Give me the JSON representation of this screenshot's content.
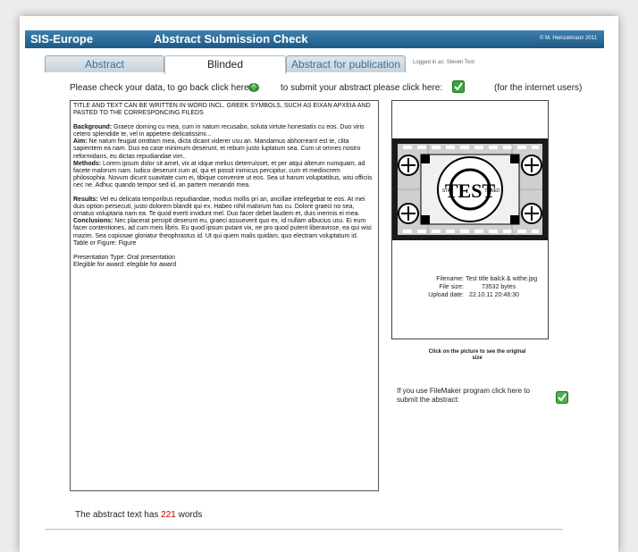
{
  "header": {
    "app_name": "SIS-Europe",
    "title": "Abstract Submission Check",
    "copyright": "© M. Heinzelmann 2011"
  },
  "tabs": [
    {
      "label": "Abstract",
      "active": false
    },
    {
      "label": "Blinded",
      "active": true
    },
    {
      "label": "Abstract for publication",
      "active": false
    }
  ],
  "logged_in": "Logged in as: Steven Test",
  "instructions": {
    "back_text": "Please check your data, to go back click here:",
    "submit_text": "to submit your abstract please click here:",
    "internet_note": "(for the internet users)",
    "back_icon": "back-arrow-icon",
    "submit_icon": "check-icon"
  },
  "abstract": {
    "heading": "TITLE AND TEXT CAN BE WRITTEN IN WORD INCL.  GREEK SYMBOLS, SUCH AS EΙΧΑΝ ΑΡΧΕΙΑ AND PASTED TO THE CORRESPONCING FILEDS",
    "background_label": "Background:",
    "background": " Graece doming cu mea, cum in natum recusabo, soluta virtute honestatis cu eos. Duo viris cetero splendide te, vel in appetere delicatissimi...",
    "aim_label": "Aim:",
    "aim": " Ne natum feugiat omittam mea, dicta dicant viderer usu an. Mandamus abhorreant est te, clita sapientem ea nam. Duo ea case minimum deserunt, et rebum justo luptatum sea. Cum ut omnes nostro reformidans, eu dictas repudiandae vim..",
    "methods_label": "Methods:",
    "methods": " Lorem ipsum dolor sit amet, vix at idque melius deterruisset, et per atqui alterum numquam, ad facete malorum nam. Iudico deserunt cum at, qui et possit inimicus percipitur, cum et mediocrem philosophia. Novum dicunt suavitate cum ei, tibique convenire ut eos. Sea ut harum voluptatibus, wisi officiis nec ne. Adhuc quando tempor sed id, an partem menandri mea.",
    "results_label": "Results:",
    "results": " Vel eu delicata temporibus repudiandae, modus mollis pri an, ancillae intellegebat te eos. At mei duis option persecuti, justo dolorem blandit qui ex. Habeo nihil malorum has cu. Dolore graeci no sea, ornatus voluptaria nam ea. Te quod everti invidunt mel. Duo facer debet laudem et, duis inermis ei mea.",
    "conclusions_label": "Conclusions:",
    "conclusions": " Nec placerat percipit deserunt eu, graeci assueverit quo ex, id nullam albucius usu. Ei eum facer contentiones, ad cum meis libris. Eu quod ipsum putant vix, ne pro quod putent liberavisse, ea qui wisi mazim. Sea copiosae gloriatur theophrastus id. Ut qui quem malis quidam, quo electram voluptatum id.",
    "table_figure": "Table or Figure: Figure",
    "presentation_type": "Presentation Type: Oral presentation",
    "award": "Elegible for award: elegible for award"
  },
  "image": {
    "test_word": "TEST",
    "stay": "STAY",
    "tuned": "TUNED",
    "filename_label": "Filename:",
    "filename": "Test title balck & withe.jpg",
    "filesize_label": "File size:",
    "filesize": "73532 bytes",
    "upload_label": "Upload date:",
    "upload_date": "22.10.11 20:48:30",
    "click_hint": "Click on the picture to see the original size"
  },
  "filemaker": {
    "text": "If you use FileMaker program click here to submit the abstract:",
    "icon": "check-icon"
  },
  "wordcount": {
    "prefix": "The abstract text has ",
    "count": "221",
    "suffix": " words"
  },
  "colors": {
    "titlebar": "#2a6a98",
    "accent_green": "#3aa53a",
    "count_red": "#c00000"
  }
}
